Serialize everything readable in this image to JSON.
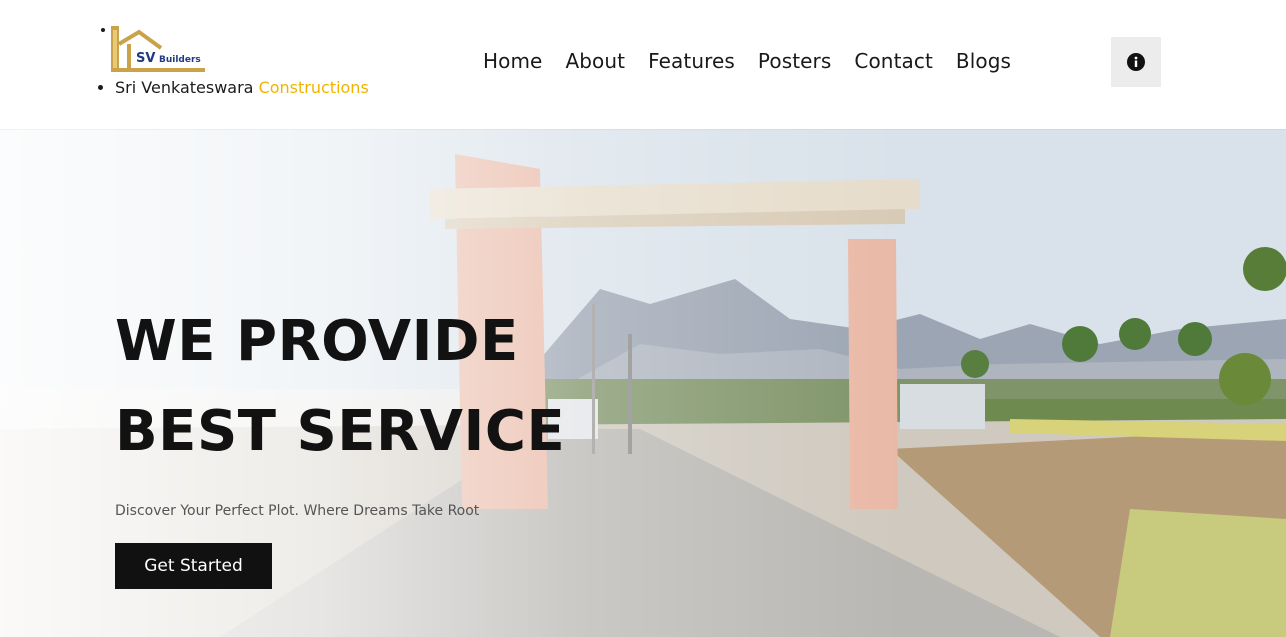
{
  "brand": {
    "logo_alt": "SV Builders",
    "logo_text": "SV",
    "logo_subtext": "Builders",
    "name_primary": "Sri Venkateswara",
    "name_accent": "Constructions"
  },
  "nav": {
    "items": [
      "Home",
      "About",
      "Features",
      "Posters",
      "Contact",
      "Blogs"
    ]
  },
  "info_button": {
    "icon": "info-icon"
  },
  "hero": {
    "title_line1": "WE PROVIDE",
    "title_line2": "BEST SERVICE",
    "subtitle": "Discover Your Perfect Plot. Where Dreams Take Root",
    "cta_label": "Get Started"
  },
  "colors": {
    "accent": "#f0b400",
    "cta_bg": "#111111",
    "info_bg": "#ececec"
  }
}
